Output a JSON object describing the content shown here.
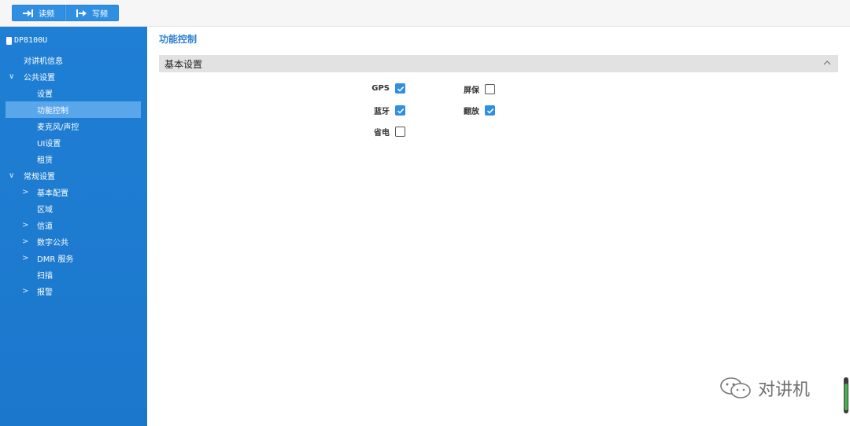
{
  "toolbar": {
    "read_label": "读频",
    "write_label": "写频",
    "accent": "#2f8fe3"
  },
  "sidebar": {
    "device_name": "DP8100U",
    "items": [
      {
        "label": "对讲机信息",
        "caret": ""
      },
      {
        "label": "公共设置",
        "caret": "∨"
      },
      {
        "label": "设置",
        "caret": ""
      },
      {
        "label": "功能控制",
        "caret": "",
        "active": true
      },
      {
        "label": "麦克风/声控",
        "caret": ""
      },
      {
        "label": "UI设置",
        "caret": ""
      },
      {
        "label": "租赁",
        "caret": ""
      },
      {
        "label": "常规设置",
        "caret": "∨"
      },
      {
        "label": "基本配置",
        "caret": ">"
      },
      {
        "label": "区域",
        "caret": ""
      },
      {
        "label": "信道",
        "caret": ">"
      },
      {
        "label": "数字公共",
        "caret": ">"
      },
      {
        "label": "DMR 服务",
        "caret": ">"
      },
      {
        "label": "扫描",
        "caret": ""
      },
      {
        "label": "报警",
        "caret": ">"
      }
    ]
  },
  "main": {
    "page_title": "功能控制",
    "section_title": "基本设置",
    "options": [
      {
        "label": "GPS",
        "checked": true
      },
      {
        "label": "屏保",
        "checked": false
      },
      {
        "label": "蓝牙",
        "checked": true
      },
      {
        "label": "翻放",
        "checked": true
      },
      {
        "label": "省电",
        "checked": false
      }
    ]
  },
  "watermark": {
    "text": "对讲机"
  }
}
